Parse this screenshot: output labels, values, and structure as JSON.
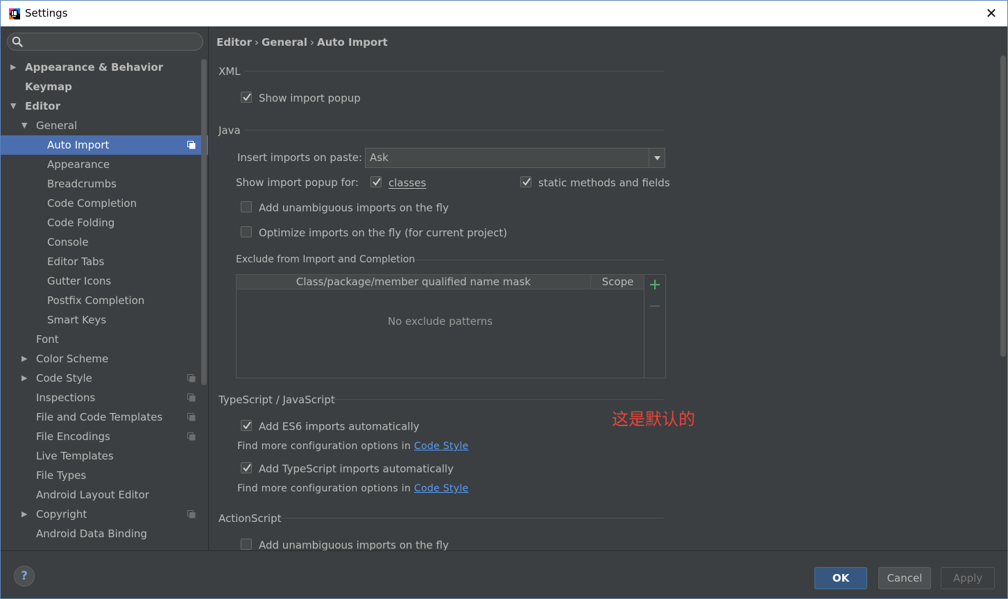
{
  "window": {
    "title": "Settings",
    "close_glyph": "✕"
  },
  "search": {
    "placeholder": "",
    "value": ""
  },
  "sidebar": {
    "items": [
      {
        "label": "Appearance & Behavior",
        "depth": 0,
        "arrow": "right",
        "bold": true
      },
      {
        "label": "Keymap",
        "depth": 0,
        "arrow": "none",
        "bold": true
      },
      {
        "label": "Editor",
        "depth": 0,
        "arrow": "down",
        "bold": true
      },
      {
        "label": "General",
        "depth": 1,
        "arrow": "down"
      },
      {
        "label": "Auto Import",
        "depth": 2,
        "arrow": "none",
        "selected": true,
        "project_icon": true
      },
      {
        "label": "Appearance",
        "depth": 2,
        "arrow": "none"
      },
      {
        "label": "Breadcrumbs",
        "depth": 2,
        "arrow": "none"
      },
      {
        "label": "Code Completion",
        "depth": 2,
        "arrow": "none"
      },
      {
        "label": "Code Folding",
        "depth": 2,
        "arrow": "none"
      },
      {
        "label": "Console",
        "depth": 2,
        "arrow": "none"
      },
      {
        "label": "Editor Tabs",
        "depth": 2,
        "arrow": "none"
      },
      {
        "label": "Gutter Icons",
        "depth": 2,
        "arrow": "none"
      },
      {
        "label": "Postfix Completion",
        "depth": 2,
        "arrow": "none"
      },
      {
        "label": "Smart Keys",
        "depth": 2,
        "arrow": "none"
      },
      {
        "label": "Font",
        "depth": 1,
        "arrow": "none"
      },
      {
        "label": "Color Scheme",
        "depth": 1,
        "arrow": "right"
      },
      {
        "label": "Code Style",
        "depth": 1,
        "arrow": "right",
        "project_icon": true
      },
      {
        "label": "Inspections",
        "depth": 1,
        "arrow": "none",
        "project_icon": true
      },
      {
        "label": "File and Code Templates",
        "depth": 1,
        "arrow": "none",
        "project_icon": true
      },
      {
        "label": "File Encodings",
        "depth": 1,
        "arrow": "none",
        "project_icon": true
      },
      {
        "label": "Live Templates",
        "depth": 1,
        "arrow": "none"
      },
      {
        "label": "File Types",
        "depth": 1,
        "arrow": "none"
      },
      {
        "label": "Android Layout Editor",
        "depth": 1,
        "arrow": "none"
      },
      {
        "label": "Copyright",
        "depth": 1,
        "arrow": "right",
        "project_icon": true
      },
      {
        "label": "Android Data Binding",
        "depth": 1,
        "arrow": "none"
      }
    ]
  },
  "breadcrumb": [
    "Editor",
    "General",
    "Auto Import"
  ],
  "breadcrumb_sep": "›",
  "xml": {
    "title": "XML",
    "show_import_popup": {
      "label": "Show import popup",
      "checked": true
    }
  },
  "java": {
    "title": "Java",
    "insert_imports_label": "Insert imports on paste:",
    "insert_imports_value": "Ask",
    "show_popup_for_label": "Show import popup for:",
    "classes": {
      "label": "classes",
      "checked": true
    },
    "static_members": {
      "label": "static methods and fields",
      "checked": true
    },
    "add_unambiguous": {
      "label": "Add unambiguous imports on the fly",
      "checked": false
    },
    "optimize_imports": {
      "label": "Optimize imports on the fly (for current project)",
      "checked": false
    },
    "exclude": {
      "title": "Exclude from Import and Completion",
      "col_mask": "Class/package/member qualified name mask",
      "col_scope": "Scope",
      "empty_text": "No exclude patterns"
    }
  },
  "typescript": {
    "title": "TypeScript / JavaScript",
    "es6": {
      "label": "Add ES6 imports automatically",
      "checked": true
    },
    "hint_prefix": "Find more configuration options in",
    "hint_link": "Code Style",
    "ts": {
      "label": "Add TypeScript imports automatically",
      "checked": true
    }
  },
  "actionscript": {
    "title": "ActionScript",
    "add_unambiguous": {
      "label": "Add unambiguous imports on the fly",
      "checked": false
    }
  },
  "annotation": "这是默认的",
  "footer": {
    "help": "?",
    "ok": "OK",
    "cancel": "Cancel",
    "apply": "Apply"
  },
  "colors": {
    "background": "#3c3f41",
    "selection": "#4b6eaf",
    "link": "#589df6",
    "annotation": "#e8443a",
    "ok_button": "#365880",
    "add_icon": "#59a869"
  }
}
